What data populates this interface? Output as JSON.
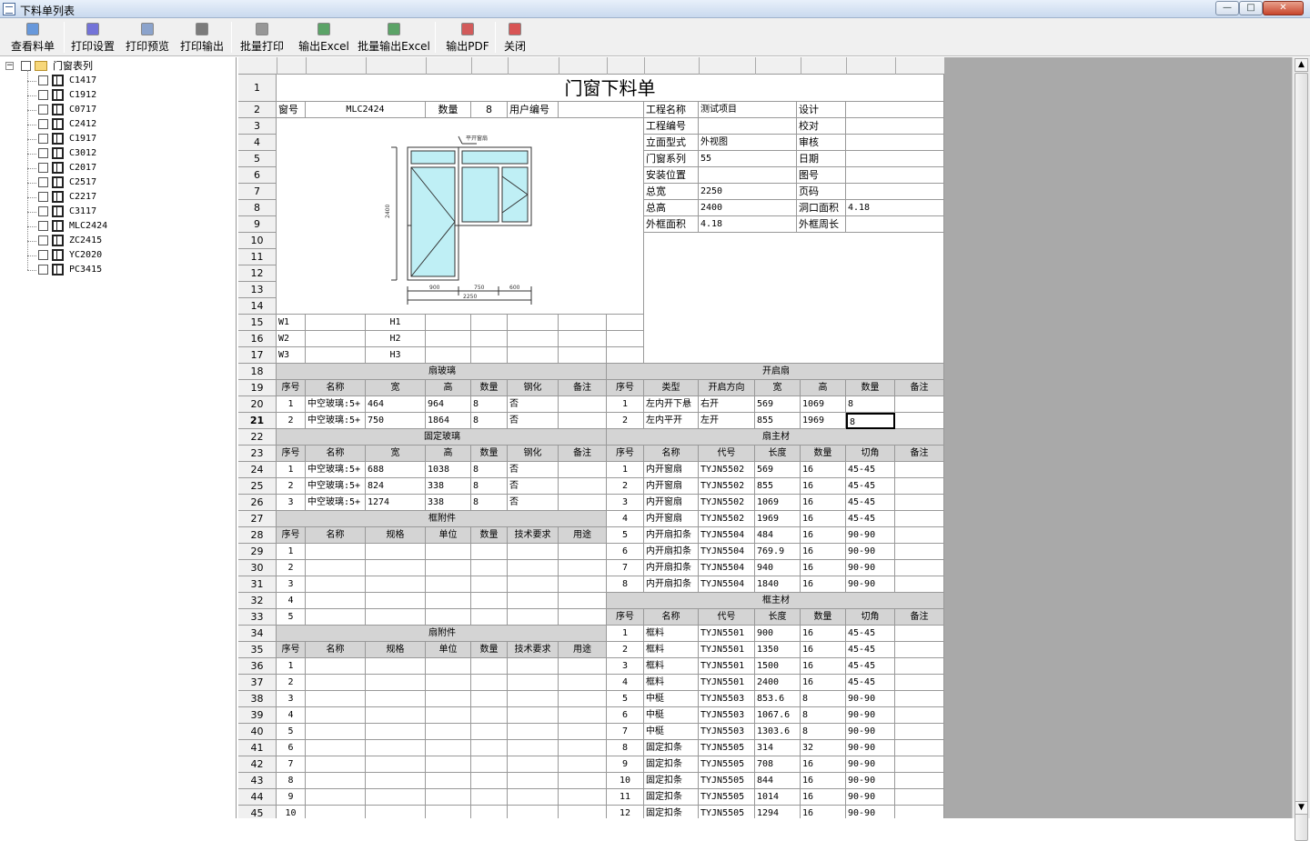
{
  "window": {
    "title": "下料单列表"
  },
  "toolbar": {
    "buttons": [
      {
        "label": "查看料单",
        "icon": "view-icon"
      },
      {
        "label": "打印设置",
        "icon": "print-setup-icon"
      },
      {
        "label": "打印预览",
        "icon": "print-preview-icon"
      },
      {
        "label": "打印输出",
        "icon": "printer-icon"
      },
      {
        "label": "批量打印",
        "icon": "batch-print-icon"
      },
      {
        "label": "输出Excel",
        "icon": "excel-icon"
      },
      {
        "label": "批量输出Excel",
        "icon": "batch-excel-icon"
      },
      {
        "label": "输出PDF",
        "icon": "pdf-icon"
      },
      {
        "label": "关闭",
        "icon": "close-icon"
      }
    ]
  },
  "tree": {
    "root": "门窗表列",
    "items": [
      "C1417",
      "C1912",
      "C0717",
      "C2412",
      "C1917",
      "C3012",
      "C2017",
      "C2517",
      "C2217",
      "C3117",
      "MLC2424",
      "ZC2415",
      "YC2020",
      "PC3415"
    ]
  },
  "sheet": {
    "title": "门窗下料单",
    "row_numbers": [
      "1",
      "2",
      "3",
      "4",
      "5",
      "6",
      "7",
      "8",
      "9",
      "10",
      "11",
      "12",
      "13",
      "14",
      "15",
      "16",
      "17",
      "18",
      "19",
      "20",
      "21",
      "22",
      "23",
      "24",
      "25",
      "26",
      "27",
      "28",
      "29",
      "30",
      "31",
      "32",
      "33",
      "34",
      "35",
      "36",
      "37",
      "38",
      "39",
      "40",
      "41",
      "42",
      "43",
      "44",
      "45"
    ],
    "header_row": {
      "window_no_label": "窗号",
      "window_no": "MLC2424",
      "qty_label": "数量",
      "qty": "8",
      "user_no_label": "用户编号"
    },
    "info": [
      [
        "工程名称",
        "测试项目",
        "设计",
        ""
      ],
      [
        "工程编号",
        "",
        "校对",
        ""
      ],
      [
        "立面型式",
        "外视图",
        "审核",
        ""
      ],
      [
        "门窗系列",
        "55",
        "日期",
        ""
      ],
      [
        "安装位置",
        "",
        "图号",
        ""
      ],
      [
        "总宽",
        "2250",
        "页码",
        ""
      ],
      [
        "总高",
        "2400",
        "洞口面积",
        "4.18"
      ],
      [
        "外框面积",
        "4.18",
        "外框周长",
        ""
      ]
    ],
    "drawing": {
      "tag": "平开窗扇",
      "dim_bottom": [
        "900",
        "750",
        "600"
      ],
      "dim_total": "2250",
      "dim_left": "2400"
    },
    "wh_rows": [
      [
        "W1",
        "H1"
      ],
      [
        "W2",
        "H2"
      ],
      [
        "W3",
        "H3"
      ]
    ],
    "sash_glass": {
      "title": "扇玻璃",
      "headers": [
        "序号",
        "名称",
        "宽",
        "高",
        "数量",
        "钢化",
        "备注"
      ],
      "rows": [
        [
          "1",
          "中空玻璃:5+",
          "464",
          "964",
          "8",
          "否",
          ""
        ],
        [
          "2",
          "中空玻璃:5+",
          "750",
          "1864",
          "8",
          "否",
          ""
        ]
      ]
    },
    "fixed_glass": {
      "title": "固定玻璃",
      "headers": [
        "序号",
        "名称",
        "宽",
        "高",
        "数量",
        "钢化",
        "备注"
      ],
      "rows": [
        [
          "1",
          "中空玻璃:5+",
          "688",
          "1038",
          "8",
          "否",
          ""
        ],
        [
          "2",
          "中空玻璃:5+",
          "824",
          "338",
          "8",
          "否",
          ""
        ],
        [
          "3",
          "中空玻璃:5+",
          "1274",
          "338",
          "8",
          "否",
          ""
        ]
      ]
    },
    "frame_acc": {
      "title": "框附件",
      "headers": [
        "序号",
        "名称",
        "规格",
        "单位",
        "数量",
        "技术要求",
        "用途"
      ],
      "rows": [
        "1",
        "2",
        "3",
        "4",
        "5"
      ]
    },
    "sash_acc": {
      "title": "扇附件",
      "headers": [
        "序号",
        "名称",
        "规格",
        "单位",
        "数量",
        "技术要求",
        "用途"
      ],
      "rows": [
        "1",
        "2",
        "3",
        "4",
        "5",
        "6",
        "7",
        "8",
        "9",
        "10"
      ]
    },
    "open_sash": {
      "title": "开启扇",
      "headers": [
        "序号",
        "类型",
        "开启方向",
        "宽",
        "高",
        "数量",
        "备注"
      ],
      "rows": [
        [
          "1",
          "左内开下悬",
          "右开",
          "569",
          "1069",
          "8",
          ""
        ],
        [
          "2",
          "左内平开",
          "左开",
          "855",
          "1969",
          "8",
          ""
        ]
      ]
    },
    "sash_profile": {
      "title": "扇主材",
      "headers": [
        "序号",
        "名称",
        "代号",
        "长度",
        "数量",
        "切角",
        "备注"
      ],
      "rows": [
        [
          "1",
          "内开窗扇",
          "TYJN5502",
          "569",
          "16",
          "45-45",
          ""
        ],
        [
          "2",
          "内开窗扇",
          "TYJN5502",
          "855",
          "16",
          "45-45",
          ""
        ],
        [
          "3",
          "内开窗扇",
          "TYJN5502",
          "1069",
          "16",
          "45-45",
          ""
        ],
        [
          "4",
          "内开窗扇",
          "TYJN5502",
          "1969",
          "16",
          "45-45",
          ""
        ],
        [
          "5",
          "内开扇扣条",
          "TYJN5504",
          "484",
          "16",
          "90-90",
          ""
        ],
        [
          "6",
          "内开扇扣条",
          "TYJN5504",
          "769.9",
          "16",
          "90-90",
          ""
        ],
        [
          "7",
          "内开扇扣条",
          "TYJN5504",
          "940",
          "16",
          "90-90",
          ""
        ],
        [
          "8",
          "内开扇扣条",
          "TYJN5504",
          "1840",
          "16",
          "90-90",
          ""
        ]
      ]
    },
    "frame_profile": {
      "title": "框主材",
      "headers": [
        "序号",
        "名称",
        "代号",
        "长度",
        "数量",
        "切角",
        "备注"
      ],
      "rows": [
        [
          "1",
          "框料",
          "TYJN5501",
          "900",
          "16",
          "45-45",
          ""
        ],
        [
          "2",
          "框料",
          "TYJN5501",
          "1350",
          "16",
          "45-45",
          ""
        ],
        [
          "3",
          "框料",
          "TYJN5501",
          "1500",
          "16",
          "45-45",
          ""
        ],
        [
          "4",
          "框料",
          "TYJN5501",
          "2400",
          "16",
          "45-45",
          ""
        ],
        [
          "5",
          "中梃",
          "TYJN5503",
          "853.6",
          "8",
          "90-90",
          ""
        ],
        [
          "6",
          "中梃",
          "TYJN5503",
          "1067.6",
          "8",
          "90-90",
          ""
        ],
        [
          "7",
          "中梃",
          "TYJN5503",
          "1303.6",
          "8",
          "90-90",
          ""
        ],
        [
          "8",
          "固定扣条",
          "TYJN5505",
          "314",
          "32",
          "90-90",
          ""
        ],
        [
          "9",
          "固定扣条",
          "TYJN5505",
          "708",
          "16",
          "90-90",
          ""
        ],
        [
          "10",
          "固定扣条",
          "TYJN5505",
          "844",
          "16",
          "90-90",
          ""
        ],
        [
          "11",
          "固定扣条",
          "TYJN5505",
          "1014",
          "16",
          "90-90",
          ""
        ],
        [
          "12",
          "固定扣条",
          "TYJN5505",
          "1294",
          "16",
          "90-90",
          ""
        ]
      ]
    }
  }
}
